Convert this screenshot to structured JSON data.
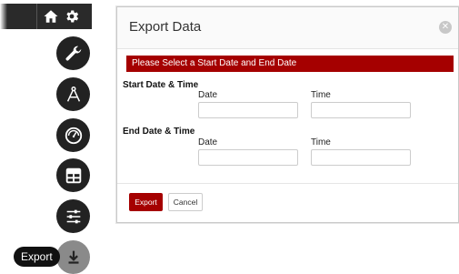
{
  "rail": {
    "items": [
      {
        "name": "wrench-icon"
      },
      {
        "name": "compass-icon"
      },
      {
        "name": "gauge-icon"
      },
      {
        "name": "layout-icon"
      },
      {
        "name": "sliders-icon"
      },
      {
        "name": "download-icon"
      }
    ],
    "tooltip": "Export"
  },
  "modal": {
    "title": "Export Data",
    "alert": "Please Select a Start Date and End Date",
    "start_section": "Start Date & Time",
    "end_section": "End Date & Time",
    "date_label": "Date",
    "time_label": "Time",
    "start_date_value": "",
    "start_time_value": "",
    "end_date_value": "",
    "end_time_value": "",
    "export_label": "Export",
    "cancel_label": "Cancel"
  },
  "colors": {
    "accent": "#a50000",
    "rail_button": "#222222",
    "rail_active": "#8a8a8a"
  }
}
